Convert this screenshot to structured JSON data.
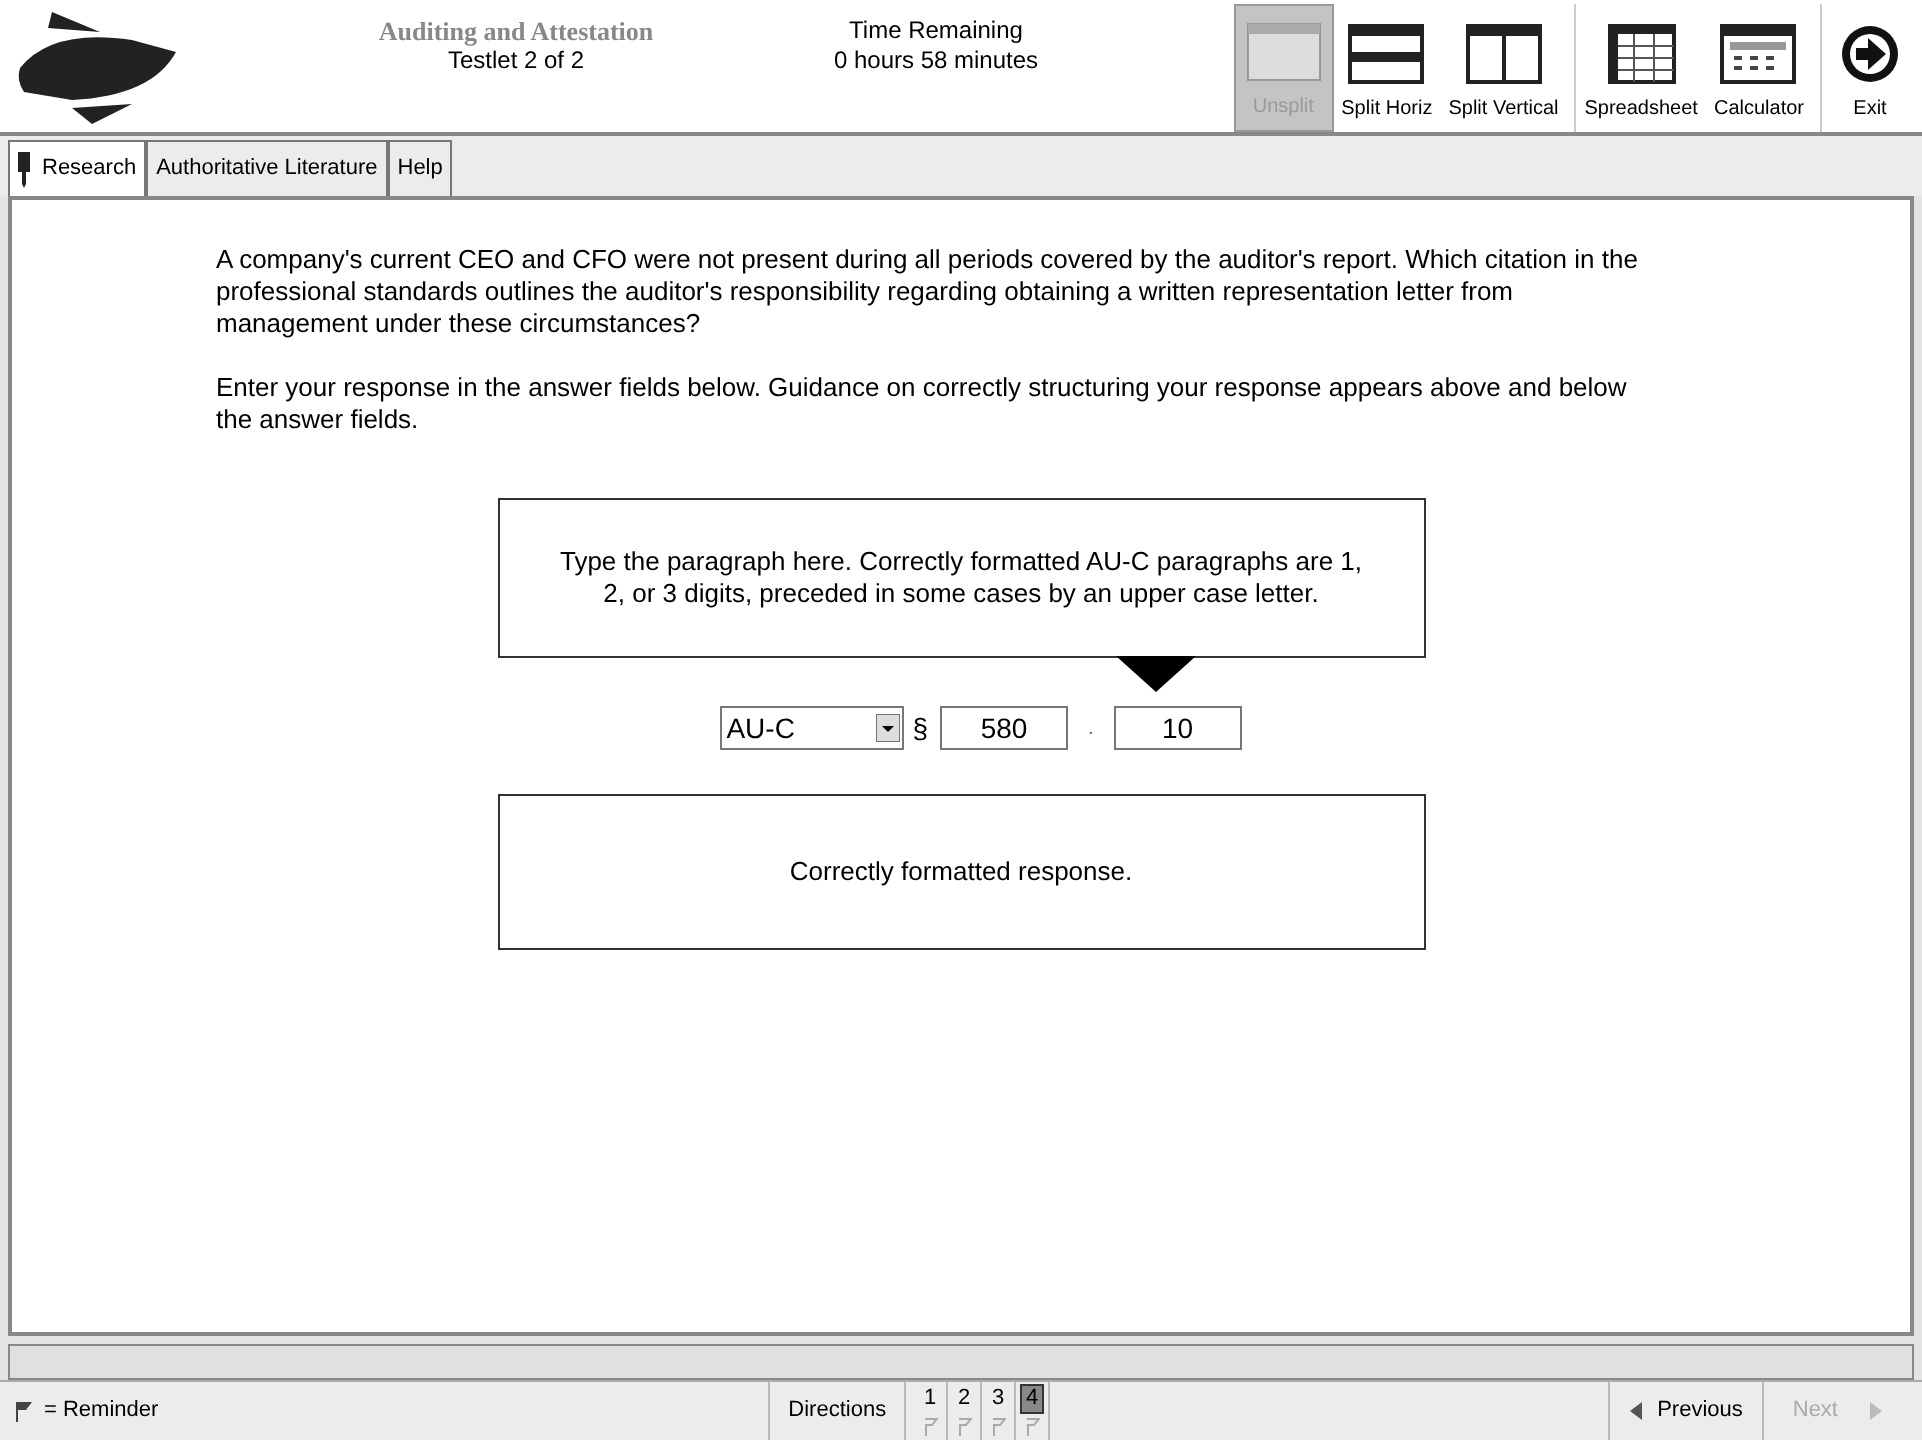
{
  "header": {
    "section": "Auditing and Attestation",
    "testlet": "Testlet 2 of 2",
    "time_label": "Time Remaining",
    "time_value": "0 hours 58 minutes"
  },
  "tools": [
    {
      "label": "Unsplit",
      "kind": "unsplit",
      "disabled": true
    },
    {
      "label": "Split Horiz",
      "kind": "split_horiz",
      "disabled": false
    },
    {
      "label": "Split Vertical",
      "kind": "split_vertical",
      "disabled": false
    },
    {
      "label": "Spreadsheet",
      "kind": "spreadsheet",
      "disabled": false
    },
    {
      "label": "Calculator",
      "kind": "calculator",
      "disabled": false
    },
    {
      "label": "Exit",
      "kind": "exit",
      "disabled": false
    }
  ],
  "tabs": [
    {
      "label": "Research",
      "selected": true
    },
    {
      "label": "Authoritative Literature",
      "selected": false
    },
    {
      "label": "Help",
      "selected": false
    }
  ],
  "question": "A company's current CEO and CFO were not present during all periods covered by the auditor's report. Which citation in the professional standards outlines the auditor's responsibility regarding obtaining a written representation letter from management under these circumstances?",
  "instructions": "Enter your response in the answer fields below. Guidance on correctly structuring your response appears above and below the answer fields.",
  "hint": "Type the paragraph here. Correctly formatted AU-C paragraphs are 1, 2, or 3 digits, preceded in some cases by an upper case letter.",
  "answer": {
    "standard": "AU-C",
    "section_sign": "§",
    "section": "580",
    "separator": ".",
    "paragraph": "10"
  },
  "feedback": "Correctly formatted response.",
  "footer": {
    "reminder": "= Reminder",
    "directions": "Directions",
    "questions": [
      {
        "label": "1",
        "selected": false
      },
      {
        "label": "2",
        "selected": false
      },
      {
        "label": "3",
        "selected": false
      },
      {
        "label": "4",
        "selected": true
      }
    ],
    "previous": {
      "label": "Previous",
      "disabled": false
    },
    "next": {
      "label": "Next",
      "disabled": true
    }
  }
}
